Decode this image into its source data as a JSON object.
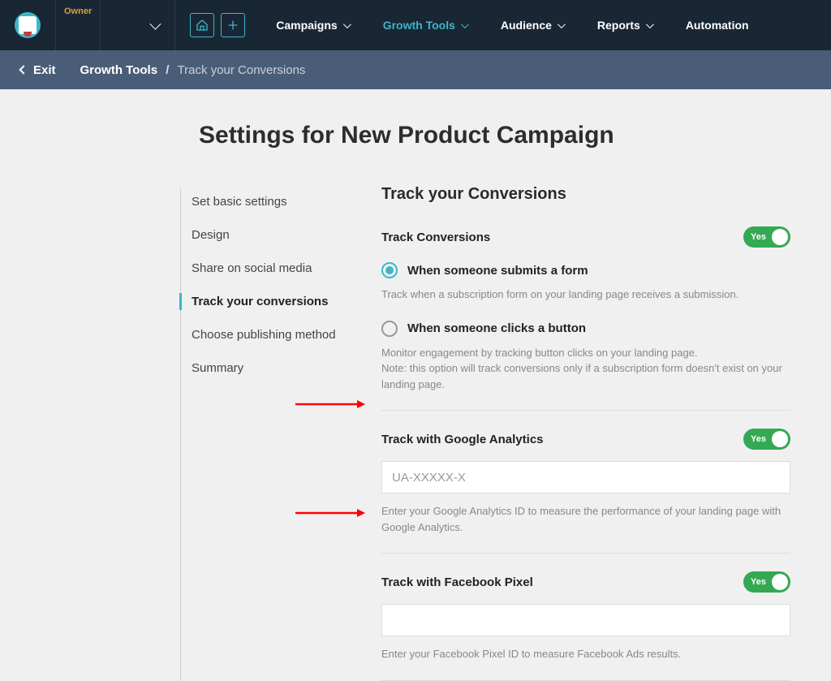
{
  "header": {
    "owner_badge": "Owner"
  },
  "nav": {
    "campaigns": "Campaigns",
    "growth_tools": "Growth Tools",
    "audience": "Audience",
    "reports": "Reports",
    "automation": "Automation"
  },
  "subnav": {
    "exit": "Exit",
    "crumb_root": "Growth Tools",
    "crumb_sep": "/",
    "crumb_tail": "Track your Conversions"
  },
  "page": {
    "title": "Settings for New Product Campaign"
  },
  "steps": [
    "Set basic settings",
    "Design",
    "Share on social media",
    "Track your conversions",
    "Choose publishing method",
    "Summary"
  ],
  "content": {
    "section_title": "Track your Conversions",
    "track_conversions": {
      "label": "Track Conversions",
      "toggle": "Yes",
      "option_form": {
        "label": "When someone submits a form",
        "help": "Track when a subscription form on your landing page receives a submission."
      },
      "option_button": {
        "label": "When someone clicks a button",
        "help1": "Monitor engagement by tracking button clicks on your landing page.",
        "help2": "Note: this option will track conversions only if a subscription form doesn't exist on your landing page."
      }
    },
    "google": {
      "label": "Track with Google Analytics",
      "toggle": "Yes",
      "placeholder": "UA-XXXXX-X",
      "help": "Enter your Google Analytics ID to measure the performance of your landing page with Google Analytics."
    },
    "facebook": {
      "label": "Track with Facebook Pixel",
      "toggle": "Yes",
      "placeholder": "",
      "help": "Enter your Facebook Pixel ID to measure Facebook Ads results."
    }
  }
}
